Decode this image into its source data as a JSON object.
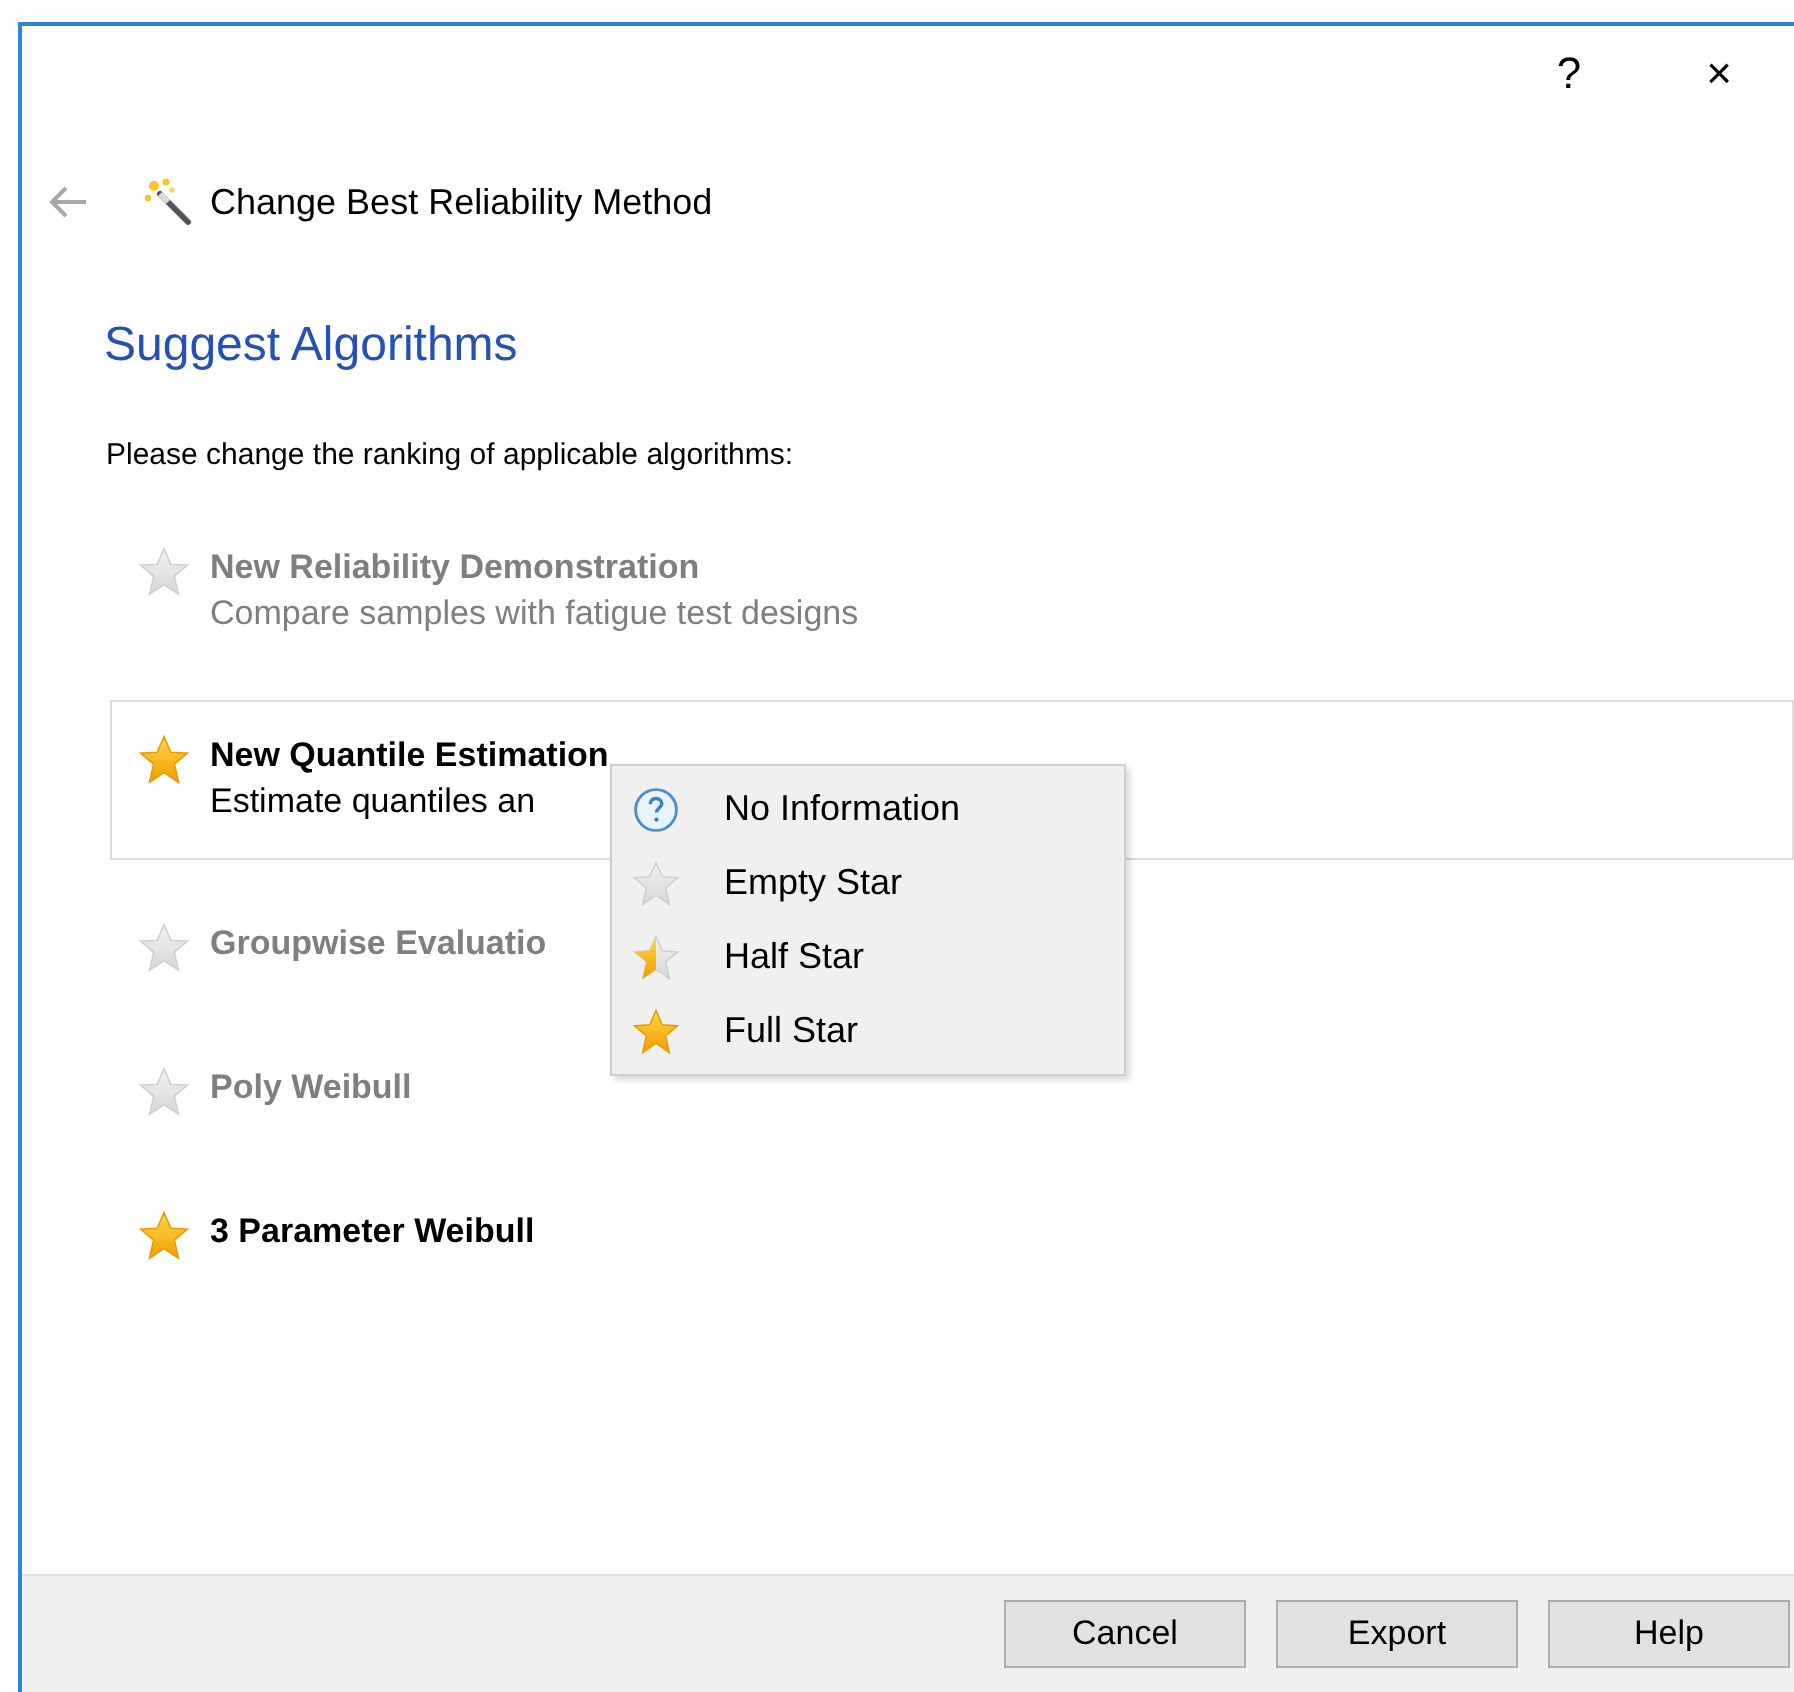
{
  "window": {
    "help_button": "?",
    "close_button": "×"
  },
  "header": {
    "title": "Change Best Reliability Method"
  },
  "heading": "Suggest Algorithms",
  "instruction": "Please change the ranking of applicable algorithms:",
  "algorithms": [
    {
      "name": "New Reliability Demonstration",
      "description": "Compare samples with fatigue test designs",
      "starred": false,
      "selected": false
    },
    {
      "name": "New Quantile Estimation",
      "description": "Estimate quantiles an",
      "starred": true,
      "selected": true
    },
    {
      "name": "Groupwise Evaluatio",
      "starred": false,
      "selected": false
    },
    {
      "name": "Poly Weibull",
      "starred": false,
      "selected": false
    },
    {
      "name": "3 Parameter Weibull",
      "starred": true,
      "selected": false
    }
  ],
  "context_menu": [
    {
      "kind": "info",
      "label": "No Information"
    },
    {
      "kind": "empty",
      "label": "Empty Star"
    },
    {
      "kind": "half",
      "label": "Half Star"
    },
    {
      "kind": "full",
      "label": "Full Star"
    }
  ],
  "buttons": [
    "Cancel",
    "Export",
    "Help"
  ]
}
